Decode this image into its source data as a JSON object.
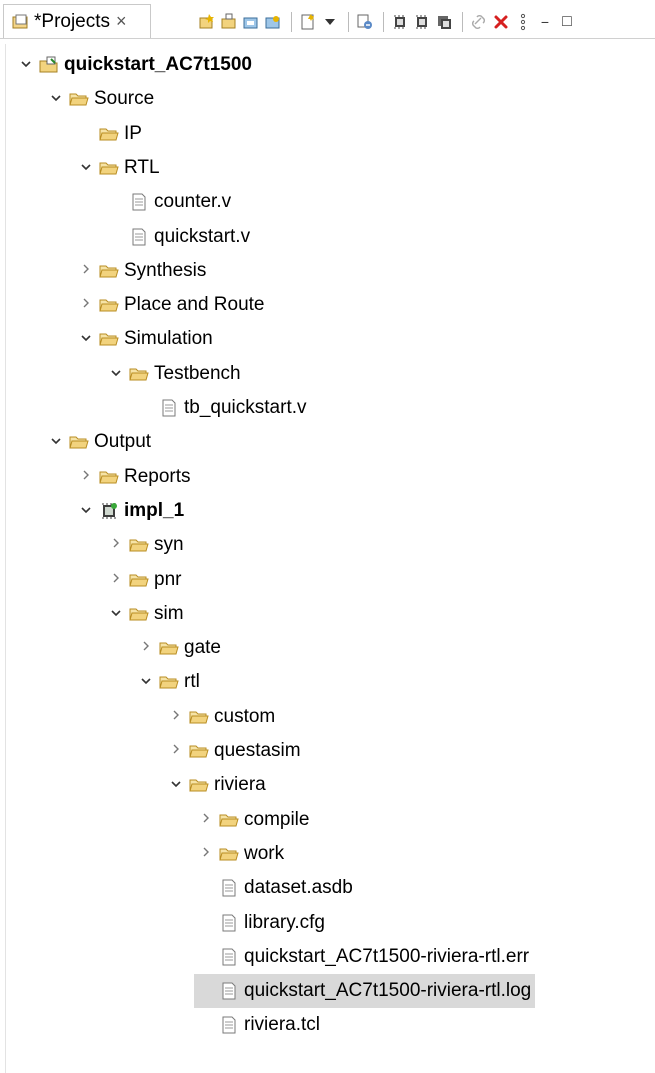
{
  "tab": {
    "title": "*Projects",
    "close": "×"
  },
  "view_menu": {
    "minimize": "−",
    "maximize": "□"
  },
  "tree": [
    {
      "label": "quickstart_AC7t1500",
      "icon": "project-icon",
      "chevron": "down",
      "depth": 0,
      "bold": true
    },
    {
      "label": "Source",
      "icon": "folder-icon",
      "chevron": "down",
      "depth": 1
    },
    {
      "label": "IP",
      "icon": "folder-icon",
      "chevron": "none",
      "depth": 2
    },
    {
      "label": "RTL",
      "icon": "folder-icon",
      "chevron": "down",
      "depth": 2
    },
    {
      "label": "counter.v",
      "icon": "file-icon",
      "chevron": "none",
      "depth": 3
    },
    {
      "label": "quickstart.v",
      "icon": "file-icon",
      "chevron": "none",
      "depth": 3
    },
    {
      "label": "Synthesis",
      "icon": "folder-icon",
      "chevron": "right",
      "depth": 2
    },
    {
      "label": "Place and Route",
      "icon": "folder-icon",
      "chevron": "right",
      "depth": 2
    },
    {
      "label": "Simulation",
      "icon": "folder-icon",
      "chevron": "down",
      "depth": 2
    },
    {
      "label": "Testbench",
      "icon": "folder-icon",
      "chevron": "down",
      "depth": 3
    },
    {
      "label": "tb_quickstart.v",
      "icon": "file-icon",
      "chevron": "none",
      "depth": 4
    },
    {
      "label": "Output",
      "icon": "folder-icon",
      "chevron": "down",
      "depth": 1
    },
    {
      "label": "Reports",
      "icon": "folder-icon",
      "chevron": "right",
      "depth": 2
    },
    {
      "label": "impl_1",
      "icon": "chip-icon",
      "chevron": "down",
      "depth": 2,
      "bold": true
    },
    {
      "label": "syn",
      "icon": "folder-icon",
      "chevron": "right",
      "depth": 3
    },
    {
      "label": "pnr",
      "icon": "folder-icon",
      "chevron": "right",
      "depth": 3
    },
    {
      "label": "sim",
      "icon": "folder-icon",
      "chevron": "down",
      "depth": 3
    },
    {
      "label": "gate",
      "icon": "folder-icon",
      "chevron": "right",
      "depth": 4
    },
    {
      "label": "rtl",
      "icon": "folder-icon",
      "chevron": "down",
      "depth": 4
    },
    {
      "label": "custom",
      "icon": "folder-icon",
      "chevron": "right",
      "depth": 5
    },
    {
      "label": "questasim",
      "icon": "folder-icon",
      "chevron": "right",
      "depth": 5
    },
    {
      "label": "riviera",
      "icon": "folder-icon",
      "chevron": "down",
      "depth": 5
    },
    {
      "label": "compile",
      "icon": "folder-icon",
      "chevron": "right",
      "depth": 6
    },
    {
      "label": "work",
      "icon": "folder-icon",
      "chevron": "right",
      "depth": 6
    },
    {
      "label": "dataset.asdb",
      "icon": "file-icon",
      "chevron": "none",
      "depth": 6
    },
    {
      "label": "library.cfg",
      "icon": "file-icon",
      "chevron": "none",
      "depth": 6
    },
    {
      "label": "quickstart_AC7t1500-riviera-rtl.err",
      "icon": "file-icon",
      "chevron": "none",
      "depth": 6
    },
    {
      "label": "quickstart_AC7t1500-riviera-rtl.log",
      "icon": "file-icon",
      "chevron": "none",
      "depth": 6,
      "selected": true
    },
    {
      "label": "riviera.tcl",
      "icon": "file-icon",
      "chevron": "none",
      "depth": 6
    }
  ],
  "colors": {
    "folder": "#c9a23a",
    "selection": "#d9d9d9",
    "delete": "#d62020"
  }
}
